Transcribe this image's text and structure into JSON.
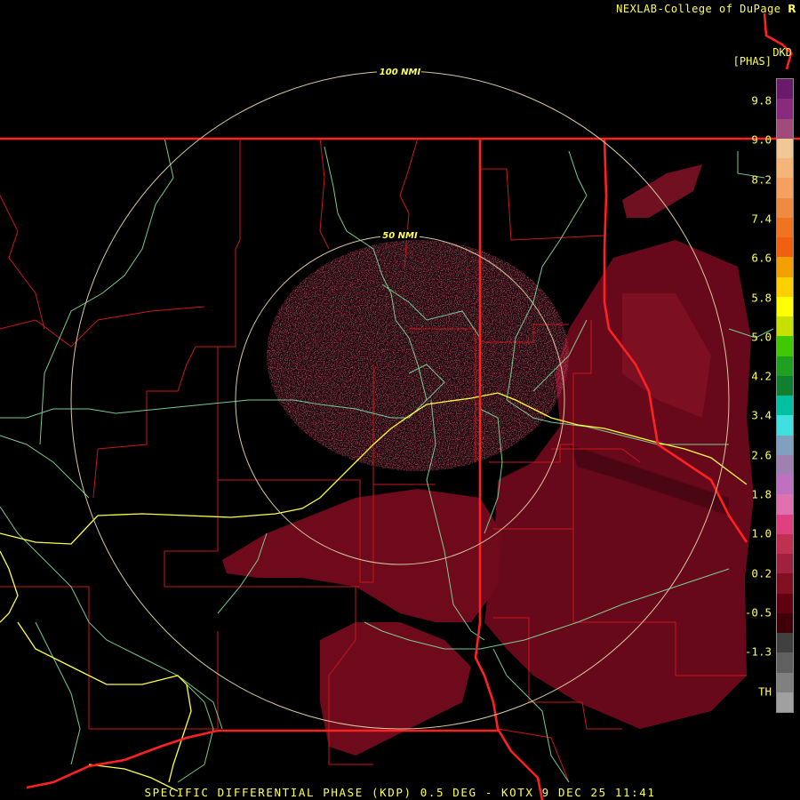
{
  "header": {
    "credit": "NEXLAB-College of DuPage"
  },
  "footer": {
    "caption": "SPECIFIC DIFFERENTIAL PHASE (KDP) 0.5 DEG - KOTX 9 DEC 25 11:41"
  },
  "product": {
    "site_id": "DKD",
    "units": "[PHAS]"
  },
  "range_rings": [
    {
      "label": "50 NMI"
    },
    {
      "label": "100 NMI"
    }
  ],
  "legend": {
    "ticks": [
      "9.8",
      "9.0",
      "8.2",
      "7.4",
      "6.6",
      "5.8",
      "5.0",
      "4.2",
      "3.4",
      "2.6",
      "1.8",
      "1.0",
      "0.2",
      "-0.5",
      "-1.3",
      "TH"
    ],
    "colors": [
      "#6a1a6a",
      "#8a2a7e",
      "#a04b7a",
      "#f0c896",
      "#f5b578",
      "#f5a060",
      "#f08a40",
      "#f07420",
      "#f06010",
      "#f2a000",
      "#ffd000",
      "#ffff00",
      "#c8e000",
      "#40c800",
      "#20a020",
      "#108030",
      "#00c0a0",
      "#40e0e0",
      "#80a0c0",
      "#a080b0",
      "#c070c0",
      "#e070b0",
      "#e04080",
      "#c03050",
      "#a02040",
      "#801020",
      "#600010",
      "#400008",
      "#404040",
      "#606060",
      "#808080",
      "#a0a0a0"
    ]
  },
  "colors": {
    "state_border": "#ff2020",
    "county_border": "#c81818",
    "road": "#80e0a0",
    "interstate": "#ffff40",
    "range_ring": "#d8c8a0",
    "echo": "#7a1020"
  }
}
